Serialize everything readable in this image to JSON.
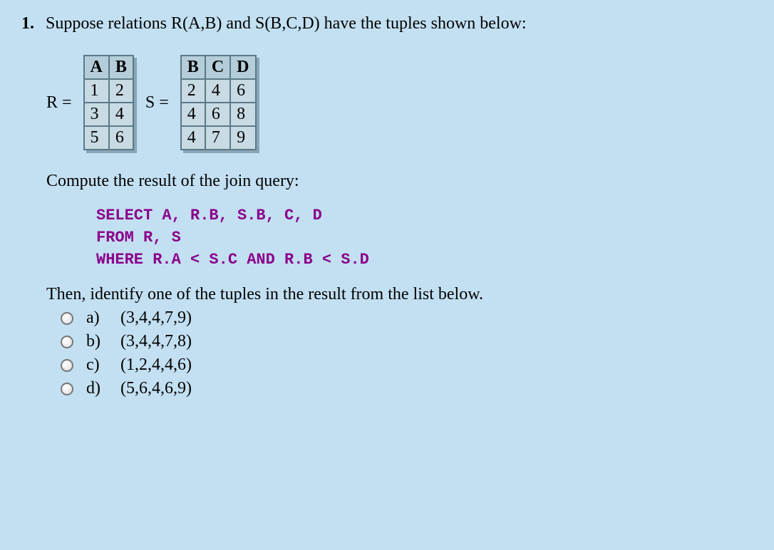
{
  "question": {
    "number": "1.",
    "intro": "Suppose relations R(A,B) and S(B,C,D) have the tuples shown below:",
    "relationR": {
      "label": "R =",
      "headers": [
        "A",
        "B"
      ],
      "rows": [
        [
          "1",
          "2"
        ],
        [
          "3",
          "4"
        ],
        [
          "5",
          "6"
        ]
      ]
    },
    "relationS": {
      "label": "S =",
      "headers": [
        "B",
        "C",
        "D"
      ],
      "rows": [
        [
          "2",
          "4",
          "6"
        ],
        [
          "4",
          "6",
          "8"
        ],
        [
          "4",
          "7",
          "9"
        ]
      ]
    },
    "computeText": "Compute the result of the join query:",
    "code": "SELECT A, R.B, S.B, C, D\nFROM R, S\nWHERE R.A < S.C AND R.B < S.D",
    "identifyText": "Then, identify one of the tuples in the result from the list below.",
    "choices": [
      {
        "label": "a)",
        "value": "(3,4,4,7,9)"
      },
      {
        "label": "b)",
        "value": "(3,4,4,7,8)"
      },
      {
        "label": "c)",
        "value": "(1,2,4,4,6)"
      },
      {
        "label": "d)",
        "value": "(5,6,4,6,9)"
      }
    ]
  }
}
